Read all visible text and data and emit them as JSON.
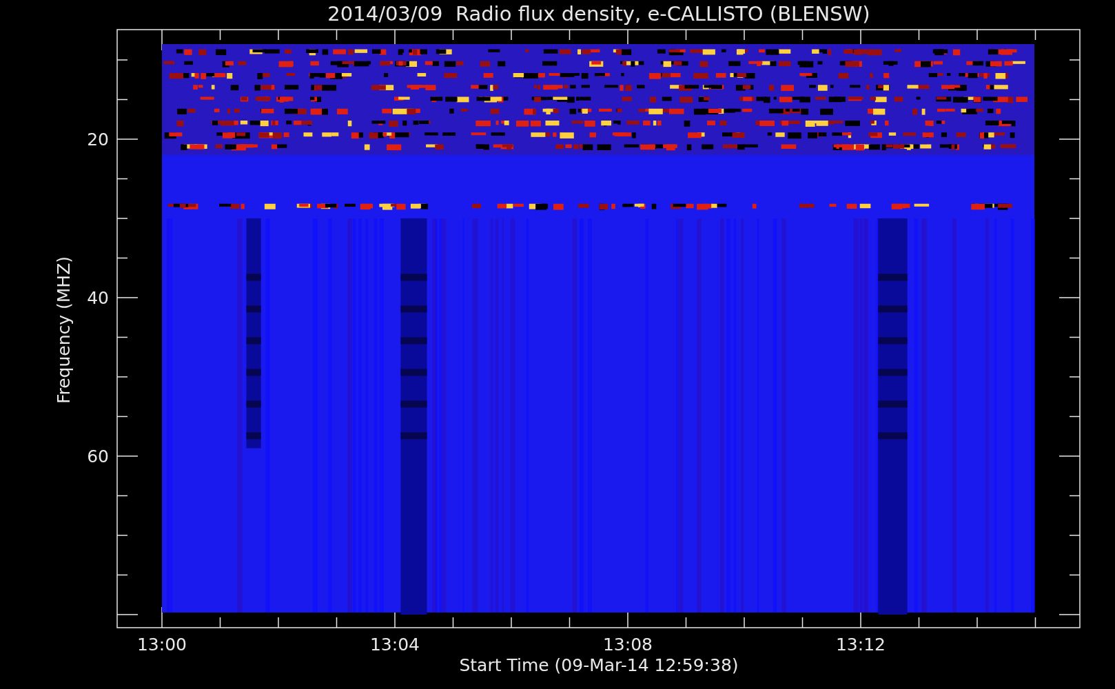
{
  "title": "2014/03/09  Radio flux density, e-CALLISTO (BLENSW)",
  "y_axis": {
    "label": "Frequency (MHZ)",
    "tick_labels": [
      "20",
      "40",
      "60"
    ]
  },
  "x_axis": {
    "label": "Start Time (09-Mar-14 12:59:38)",
    "tick_labels": [
      "13:00",
      "13:04",
      "13:08",
      "13:12"
    ]
  }
}
